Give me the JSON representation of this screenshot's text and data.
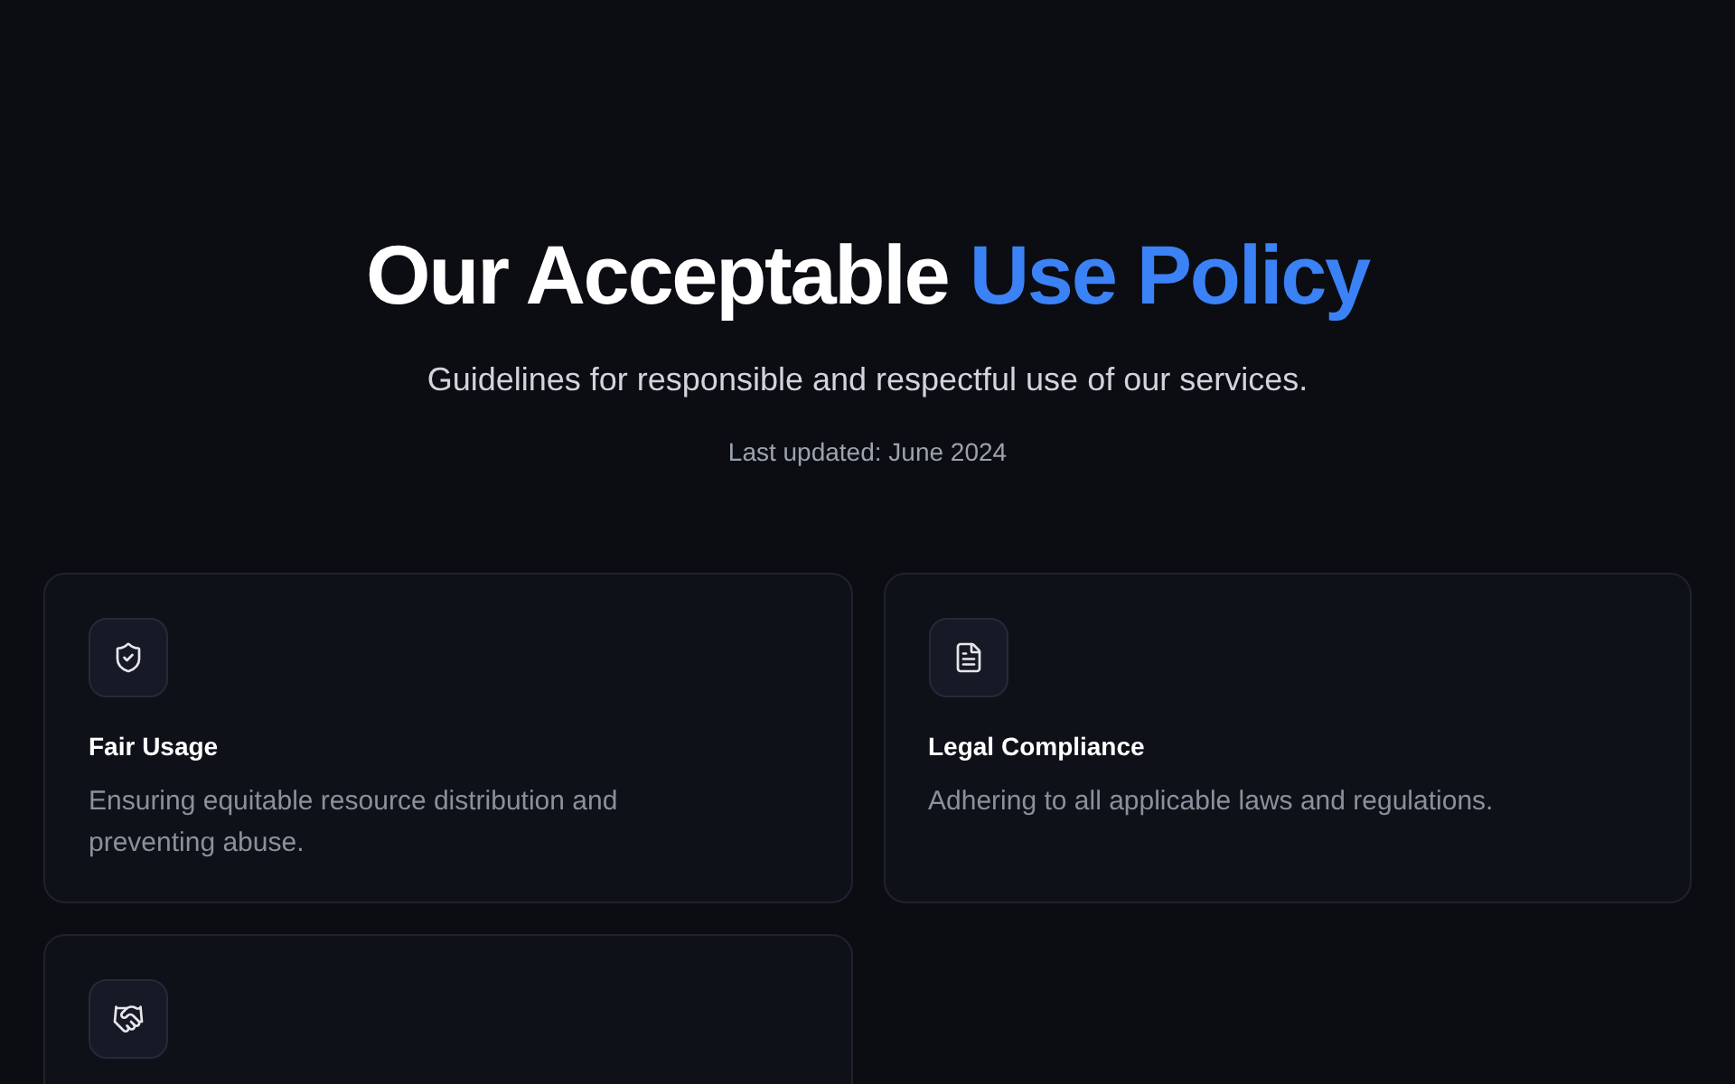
{
  "header": {
    "title": "Our Acceptable",
    "title_highlight": "Use Policy",
    "subtitle": "Guidelines for responsible and respectful use of our services.",
    "updated": "Last updated: June 2024"
  },
  "cards": [
    {
      "kind": "shield",
      "title": "Fair Usage",
      "description": "Ensuring equitable resource distribution and preventing abuse."
    },
    {
      "kind": "document",
      "title": "Legal Compliance",
      "description": "Adhering to all applicable laws and regulations."
    },
    {
      "kind": "handshake"
    }
  ]
}
